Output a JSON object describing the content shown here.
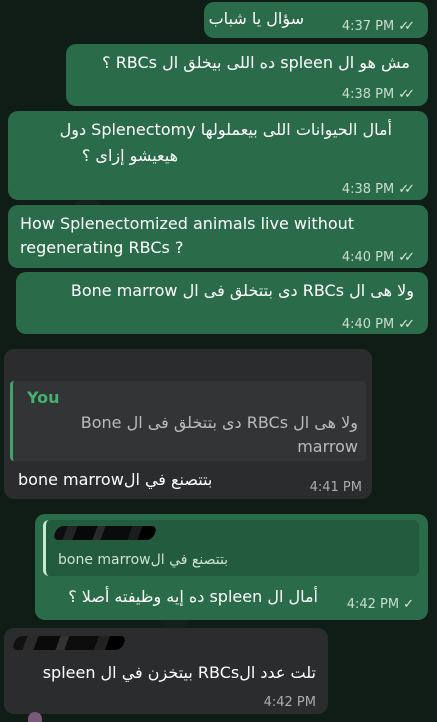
{
  "messages": [
    {
      "text": "سؤال يا شباب",
      "time": "4:37 PM",
      "status": "read"
    },
    {
      "text": "مش هو ال spleen ده اللى بيخلق ال RBCs ؟",
      "time": "4:38 PM",
      "status": "read"
    },
    {
      "line1": "أمال الحيوانات اللى بيعملولها Splenectomy دول",
      "line2": "هيعيشو إزاى ؟",
      "time": "4:38 PM",
      "status": "read"
    },
    {
      "line1": "How Splenectomized animals live without",
      "line2": "regenerating RBCs ?",
      "time": "4:40 PM",
      "status": "read"
    },
    {
      "text": "ولا هى ال RBCs دى بتتخلق فى ال Bone marrow",
      "time": "4:40 PM",
      "status": "read"
    },
    {
      "reply_name": "You",
      "reply_line1": "ولا هى ال RBCs دى بتتخلق فى ال Bone",
      "reply_line2": "marrow",
      "text": "بتتصنع في الbone marrow",
      "time": "4:41 PM"
    },
    {
      "reply_text": "بتتصنع في الbone marrow",
      "text": "أمال ال spleen ده إيه وظيفته أصلا ؟",
      "time": "4:42 PM",
      "status": "sent"
    },
    {
      "text": "تلت عدد الRBCs بيتخزن في ال spleen",
      "time": "4:42 PM"
    }
  ],
  "icons": {
    "read": "double-check-icon",
    "sent": "single-check-icon"
  },
  "colors": {
    "outgoing": "#2a6b4a",
    "incoming": "#2a2c2e",
    "reply_name": "#44b36f"
  }
}
